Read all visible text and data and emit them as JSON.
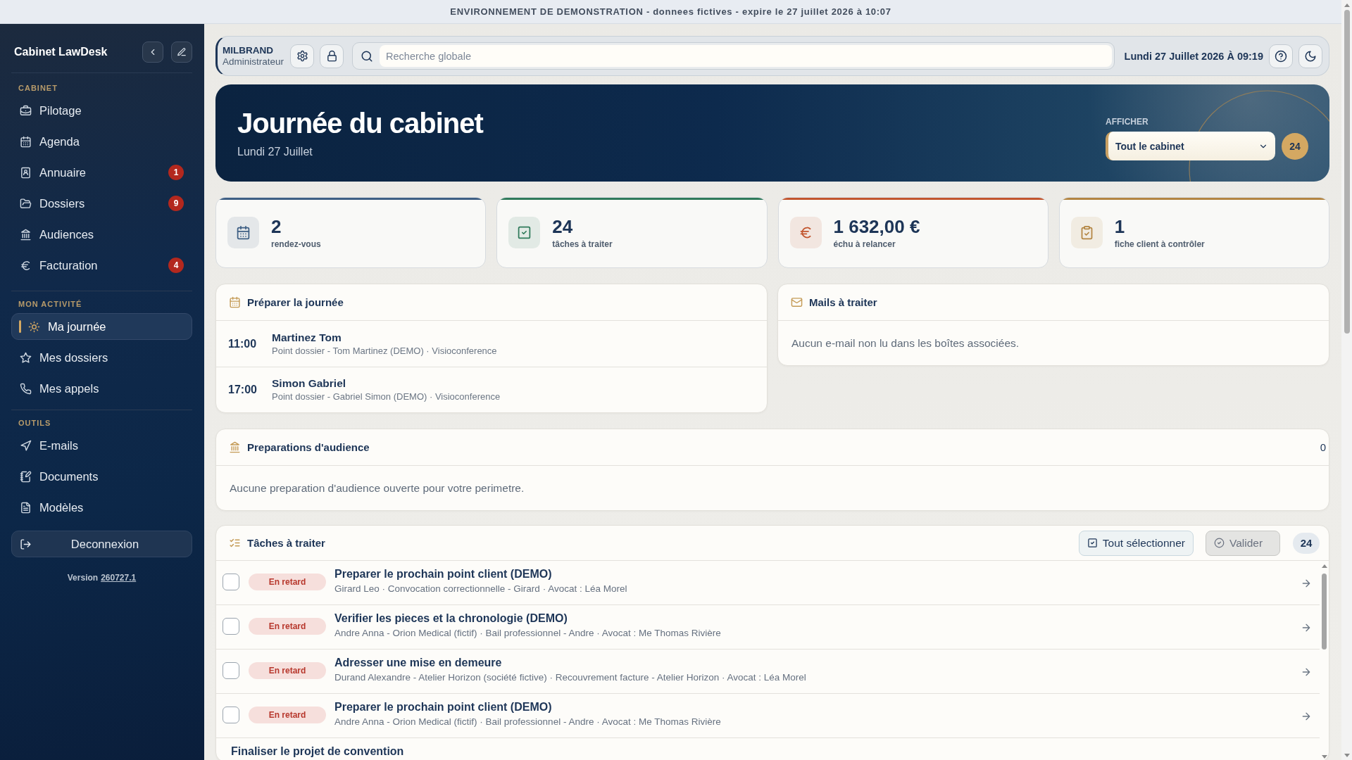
{
  "banner": {
    "text": "ENVIRONNEMENT DE DEMONSTRATION - donnees fictives - expire le 27 juillet 2026 à 10:07"
  },
  "sidebar": {
    "title": "Cabinet LawDesk",
    "sections": [
      {
        "label": "CABINET",
        "items": [
          {
            "label": "Pilotage",
            "selected": false
          },
          {
            "label": "Agenda",
            "selected": false
          },
          {
            "label": "Annuaire",
            "badge": "1",
            "selected": false
          },
          {
            "label": "Dossiers",
            "badge": "9",
            "selected": false
          },
          {
            "label": "Audiences",
            "selected": false
          },
          {
            "label": "Facturation",
            "badge": "4",
            "selected": false
          }
        ]
      },
      {
        "label": "MON ACTIVITÉ",
        "items": [
          {
            "label": "Ma journée",
            "selected": true
          },
          {
            "label": "Mes dossiers",
            "selected": false
          },
          {
            "label": "Mes appels",
            "selected": false
          }
        ]
      },
      {
        "label": "OUTILS",
        "items": [
          {
            "label": "E-mails",
            "selected": false
          },
          {
            "label": "Documents",
            "selected": false
          },
          {
            "label": "Modèles",
            "selected": false
          }
        ]
      }
    ],
    "logout": "Deconnexion",
    "version": {
      "label": "Version",
      "number": "260727.1"
    }
  },
  "topbar": {
    "user": {
      "name": "MILBRAND",
      "role": "Administrateur"
    },
    "search": {
      "placeholder": "Recherche globale"
    },
    "datetime": "Lundi 27 Juillet 2026 À 09:19"
  },
  "hero": {
    "title": "Journée du cabinet",
    "subtitle": "Lundi 27 Juillet",
    "filter": {
      "label": "AFFICHER",
      "value": "Tout le cabinet"
    },
    "count": "24"
  },
  "stats": [
    {
      "value": "2",
      "label": "rendez-vous",
      "color": "#3e5f84"
    },
    {
      "value": "24",
      "label": "tâches à traiter",
      "color": "#2f7a5a"
    },
    {
      "value": "1 632,00 €",
      "label": "échu à relancer",
      "color": "#c2552e"
    },
    {
      "value": "1",
      "label": "fiche client à contrôler",
      "color": "#b38542"
    }
  ],
  "day_panel": {
    "title": "Préparer la journée",
    "events": [
      {
        "time": "11:00",
        "name": "Martinez Tom",
        "details": "Point dossier - Tom Martinez (DEMO) · Visioconference"
      },
      {
        "time": "17:00",
        "name": "Simon Gabriel",
        "details": "Point dossier - Gabriel Simon (DEMO) · Visioconference"
      }
    ]
  },
  "mail_panel": {
    "title": "Mails à traiter",
    "empty_text": "Aucun e-mail non lu dans les boîtes associées."
  },
  "hearings_panel": {
    "title": "Preparations d'audience",
    "count": "0",
    "empty_text": "Aucune preparation d'audience ouverte pour votre perimetre."
  },
  "tasks_panel": {
    "title": "Tâches à traiter",
    "select_all": "Tout sélectionner",
    "validate": {
      "label": "Valider",
      "disabled": true
    },
    "count": "24",
    "tasks": [
      {
        "checked": false,
        "status": "En retard",
        "title": "Preparer le prochain point client (DEMO)",
        "details": "Girard Leo · Convocation correctionnelle - Girard · Avocat : Léa Morel"
      },
      {
        "checked": false,
        "status": "En retard",
        "title": "Verifier les pieces et la chronologie (DEMO)",
        "details": "Andre Anna - Orion Medical (fictif) · Bail professionnel - Andre · Avocat : Me Thomas Rivière"
      },
      {
        "checked": false,
        "status": "En retard",
        "title": "Adresser une mise en demeure",
        "details": "Durand Alexandre - Atelier Horizon (société fictive) · Recouvrement facture - Atelier Horizon · Avocat : Léa Morel"
      },
      {
        "checked": false,
        "status": "En retard",
        "title": "Preparer le prochain point client (DEMO)",
        "details": "Andre Anna - Orion Medical (fictif) · Bail professionnel - Andre · Avocat : Me Thomas Rivière"
      },
      {
        "title": "Finaliser le projet de convention"
      }
    ]
  }
}
